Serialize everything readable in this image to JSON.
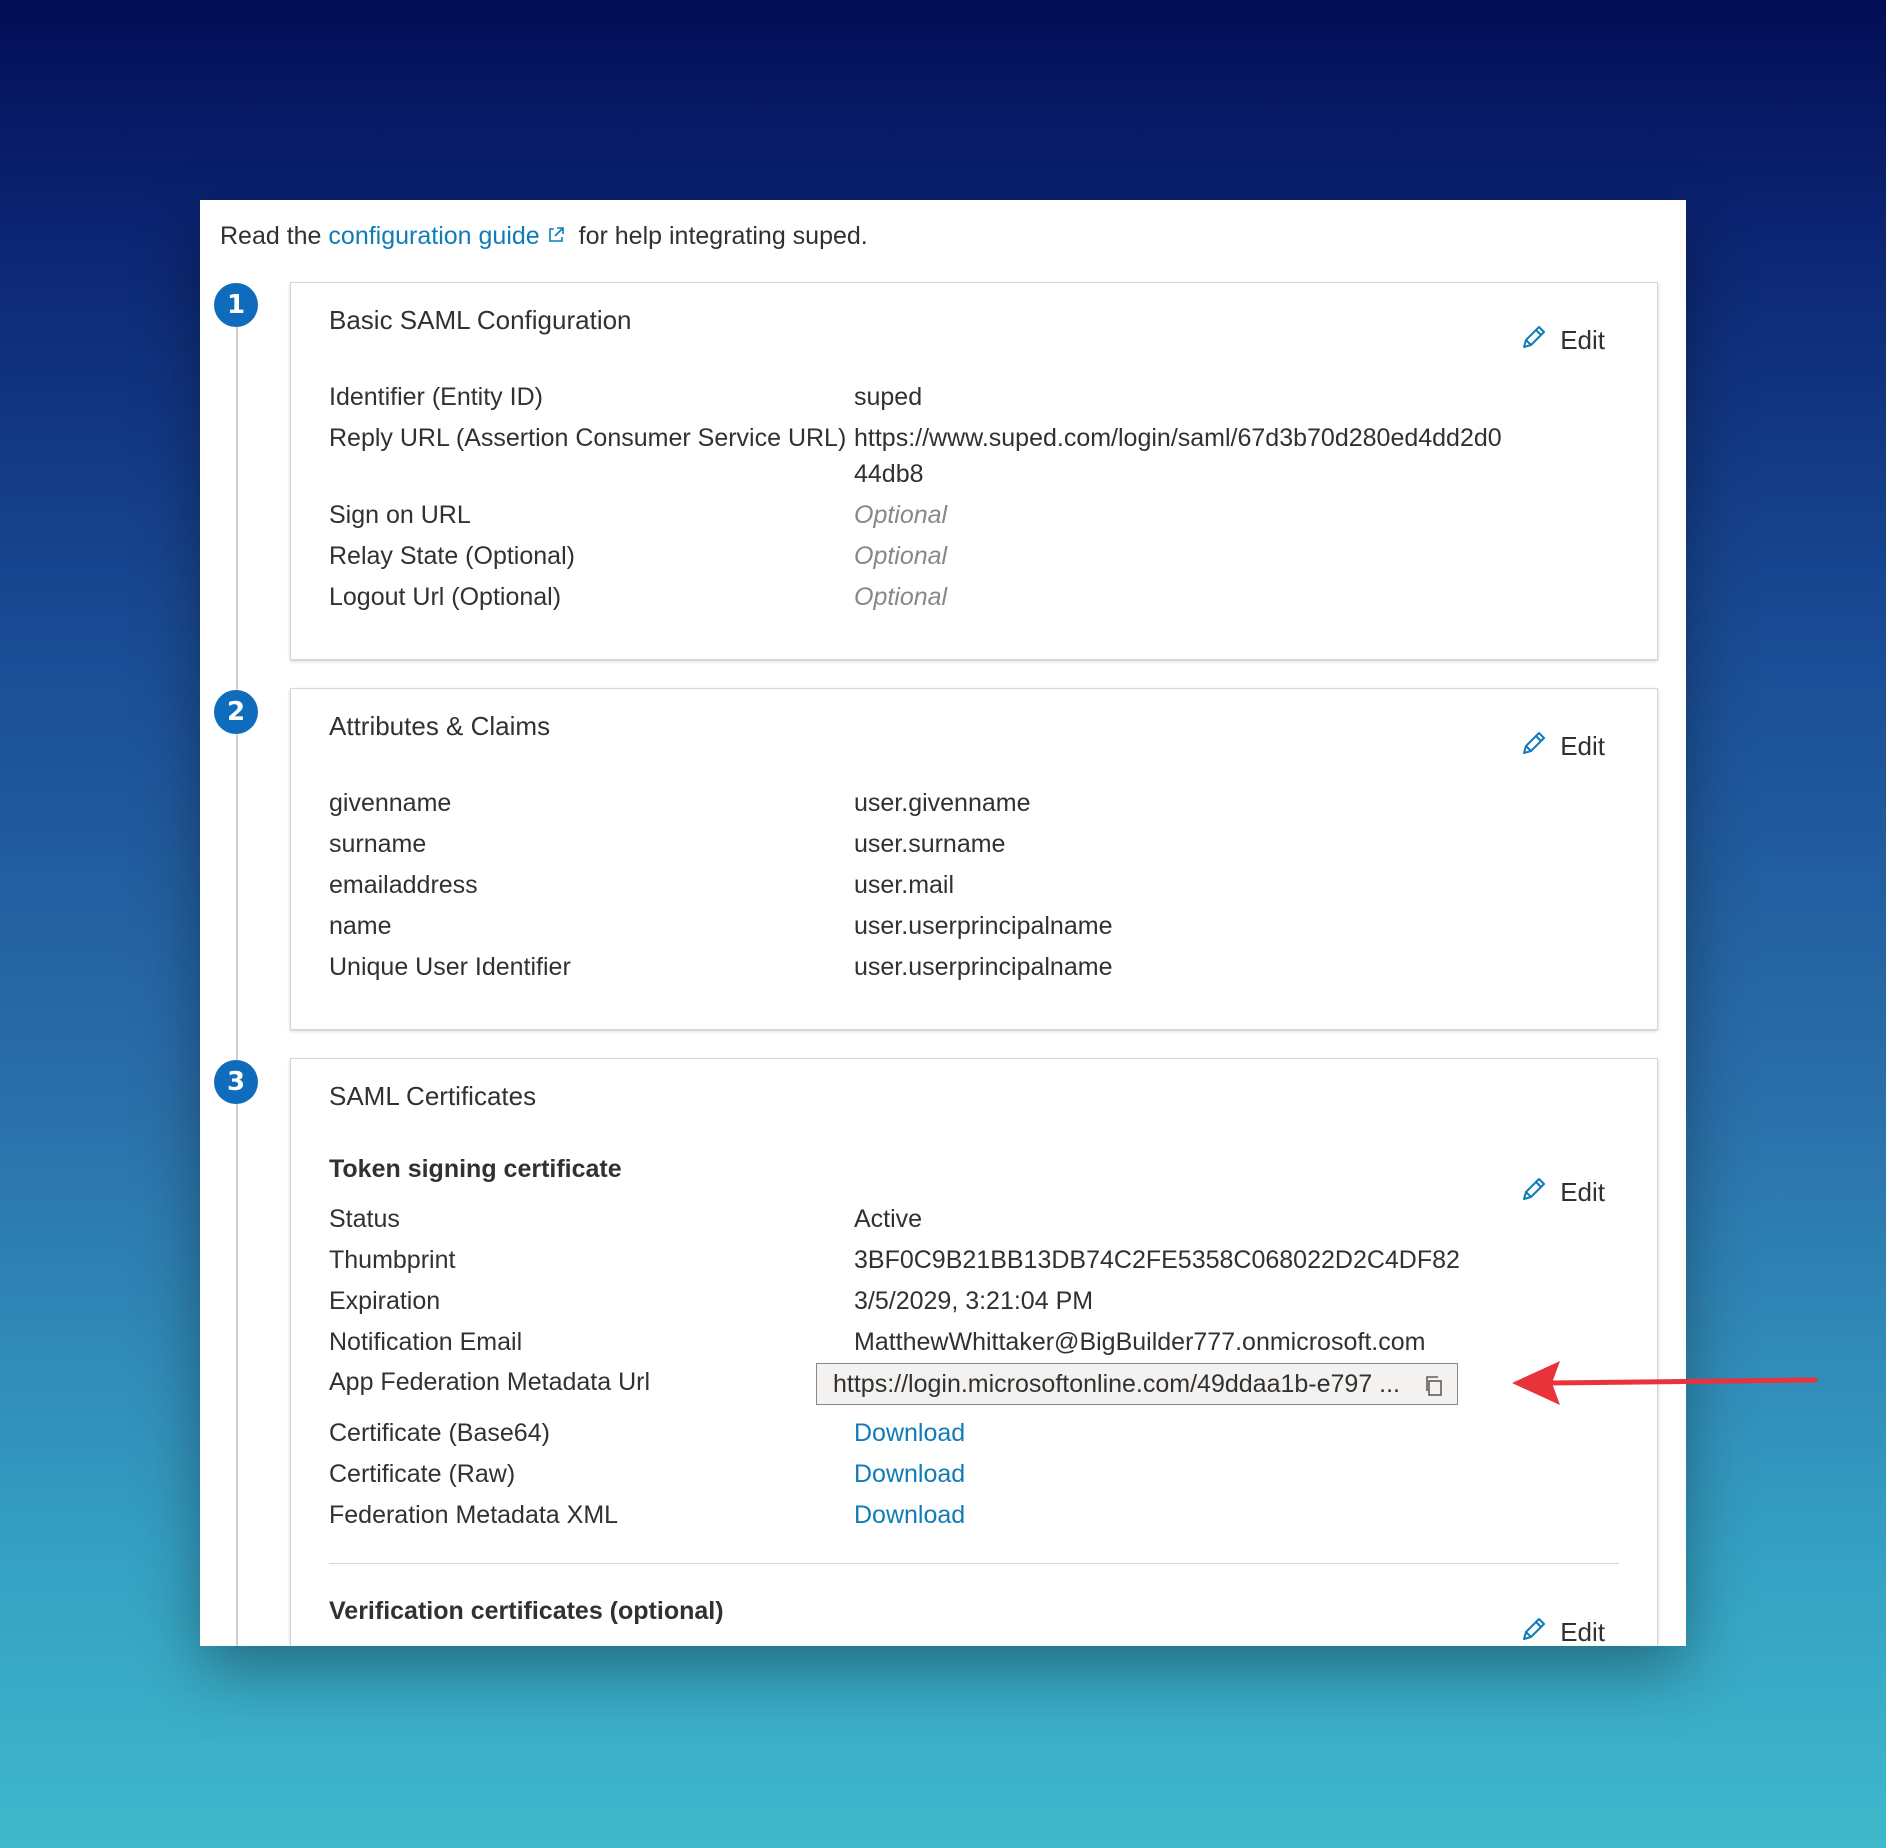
{
  "intro": {
    "prefix": "Read the",
    "link": "configuration guide",
    "suffix": "for help integrating suped."
  },
  "steps": [
    "1",
    "2",
    "3"
  ],
  "basic_saml": {
    "title": "Basic SAML Configuration",
    "edit": "Edit",
    "rows": [
      {
        "label": "Identifier (Entity ID)",
        "value": "suped"
      },
      {
        "label": "Reply URL (Assertion Consumer Service URL)",
        "value": "https://www.suped.com/login/saml/67d3b70d280ed4dd2d044db8"
      },
      {
        "label": "Sign on URL",
        "value": "Optional"
      },
      {
        "label": "Relay State (Optional)",
        "value": "Optional"
      },
      {
        "label": "Logout Url (Optional)",
        "value": "Optional"
      }
    ]
  },
  "attributes": {
    "title": "Attributes & Claims",
    "edit": "Edit",
    "rows": [
      {
        "label": "givenname",
        "value": "user.givenname"
      },
      {
        "label": "surname",
        "value": "user.surname"
      },
      {
        "label": "emailaddress",
        "value": "user.mail"
      },
      {
        "label": "name",
        "value": "user.userprincipalname"
      },
      {
        "label": "Unique User Identifier",
        "value": "user.userprincipalname"
      }
    ]
  },
  "certificates": {
    "title": "SAML Certificates",
    "token_heading": "Token signing certificate",
    "edit": "Edit",
    "rows": [
      {
        "label": "Status",
        "value": "Active"
      },
      {
        "label": "Thumbprint",
        "value": "3BF0C9B21BB13DB74C2FE5358C068022D2C4DF82"
      },
      {
        "label": "Expiration",
        "value": "3/5/2029, 3:21:04 PM"
      },
      {
        "label": "Notification Email",
        "value": "MatthewWhittaker@BigBuilder777.onmicrosoft.com"
      }
    ],
    "metadata_url_label": "App Federation Metadata Url",
    "metadata_url_value": "https://login.microsoftonline.com/49ddaa1b-e797 ...",
    "downloads": [
      {
        "label": "Certificate (Base64)",
        "link": "Download"
      },
      {
        "label": "Certificate (Raw)",
        "link": "Download"
      },
      {
        "label": "Federation Metadata XML",
        "link": "Download"
      }
    ],
    "verification_heading": "Verification certificates (optional)",
    "verification_edit": "Edit"
  },
  "colors": {
    "accent": "#0f7cb8",
    "step_badge": "#0f6cbd",
    "arrow": "#e8333b"
  }
}
